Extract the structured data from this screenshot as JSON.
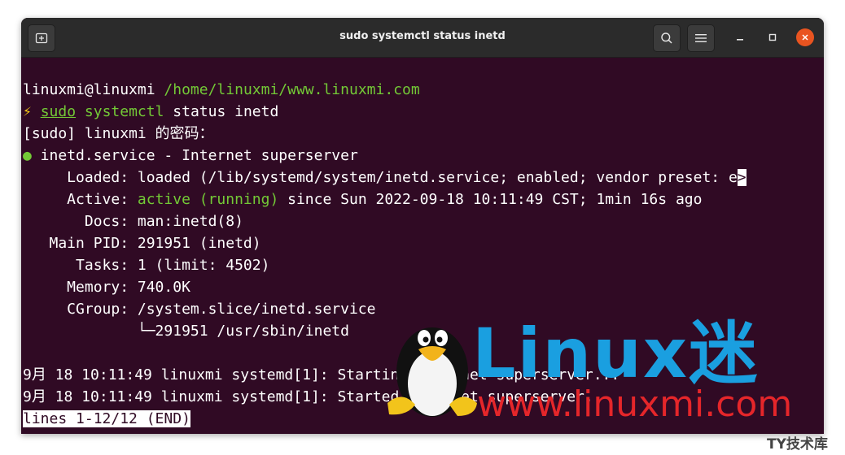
{
  "window": {
    "title": "sudo systemctl status inetd"
  },
  "terminal": {
    "prompt_user": "linuxmi@linuxmi",
    "prompt_path": "/home/linuxmi/www.linuxmi.com",
    "cmd_symbol": "⚡",
    "cmd_sudo": "sudo",
    "cmd_systemctl": "systemctl",
    "cmd_args": " status inetd",
    "sudo_prompt": "[sudo] linuxmi 的密码：",
    "status_dot": "●",
    "service_line": " inetd.service - Internet superserver",
    "loaded_line": "     Loaded: loaded (/lib/systemd/system/inetd.service; enabled; vendor preset: e",
    "truncate_marker": ">",
    "active_label": "     Active: ",
    "active_status": "active (running)",
    "active_rest": " since Sun 2022-09-18 10:11:49 CST; 1min 16s ago",
    "docs_line": "       Docs: man:inetd(8)",
    "mainpid_line": "   Main PID: 291951 (inetd)",
    "tasks_line": "      Tasks: 1 (limit: 4502)",
    "memory_line": "     Memory: 740.0K",
    "cgroup_line": "     CGroup: /system.slice/inetd.service",
    "cgroup_child_line": "             └─291951 /usr/sbin/inetd",
    "log_line_1": "9月 18 10:11:49 linuxmi systemd[1]: Starting Internet superserver...",
    "log_line_2": "9月 18 10:11:49 linuxmi systemd[1]: Started Internet superserver.",
    "pager_status": "lines 1-12/12 (END)"
  },
  "watermark": {
    "brand": "Linux迷",
    "url": "www.linuxmi.com",
    "site": "TY技术库"
  },
  "colors": {
    "terminal_bg": "#300a24",
    "green": "#73c936",
    "brand_blue": "#1a9fe0",
    "brand_red": "#e5262a",
    "close_button": "#e95420"
  }
}
